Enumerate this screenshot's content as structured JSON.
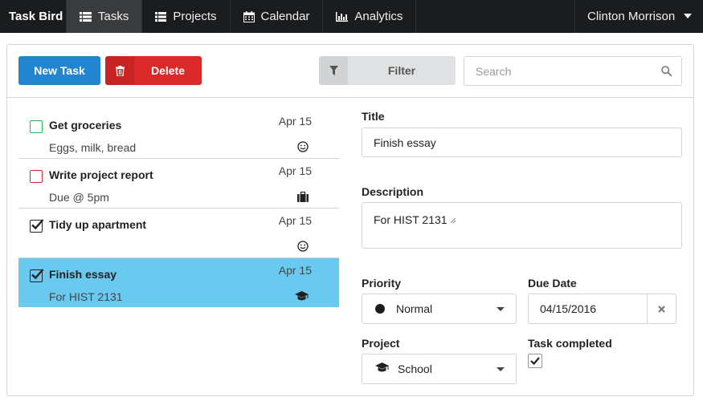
{
  "app": {
    "brand": "Task Bird"
  },
  "nav": {
    "items": [
      {
        "label": "Tasks",
        "icon": "list-icon",
        "active": true
      },
      {
        "label": "Projects",
        "icon": "grid-list-icon",
        "active": false
      },
      {
        "label": "Calendar",
        "icon": "calendar-icon",
        "active": false
      },
      {
        "label": "Analytics",
        "icon": "bar-chart-icon",
        "active": false
      }
    ],
    "user": "Clinton Morrison"
  },
  "toolbar": {
    "new_task": "New Task",
    "delete": "Delete",
    "filter": "Filter",
    "search_placeholder": "Search"
  },
  "tasks": [
    {
      "title": "Get groceries",
      "description": "Eggs, milk, bread",
      "date": "Apr 15",
      "icon": "smile-icon",
      "checkbox": "unchecked-green",
      "selected": false
    },
    {
      "title": "Write project report",
      "description": "Due @ 5pm",
      "date": "Apr 15",
      "icon": "briefcase-icon",
      "checkbox": "unchecked-red",
      "selected": false
    },
    {
      "title": "Tidy up apartment",
      "description": "",
      "date": "Apr 15",
      "icon": "smile-icon",
      "checkbox": "checked",
      "selected": false
    },
    {
      "title": "Finish essay",
      "description": "For HIST 2131",
      "date": "Apr 15",
      "icon": "graduation-cap-icon",
      "checkbox": "checked",
      "selected": true
    }
  ],
  "detail": {
    "title_label": "Title",
    "title_value": "Finish essay",
    "description_label": "Description",
    "description_value": "For HIST 2131",
    "priority_label": "Priority",
    "priority_value": "Normal",
    "due_date_label": "Due Date",
    "due_date_value": "04/15/2016",
    "project_label": "Project",
    "project_value": "School",
    "completed_label": "Task completed",
    "completed": true
  },
  "colors": {
    "navbar": "#1b1c1d",
    "primary": "#2185d0",
    "danger": "#db2828",
    "selected_row": "#6ac9ee",
    "pending_green": "#21ba45"
  }
}
